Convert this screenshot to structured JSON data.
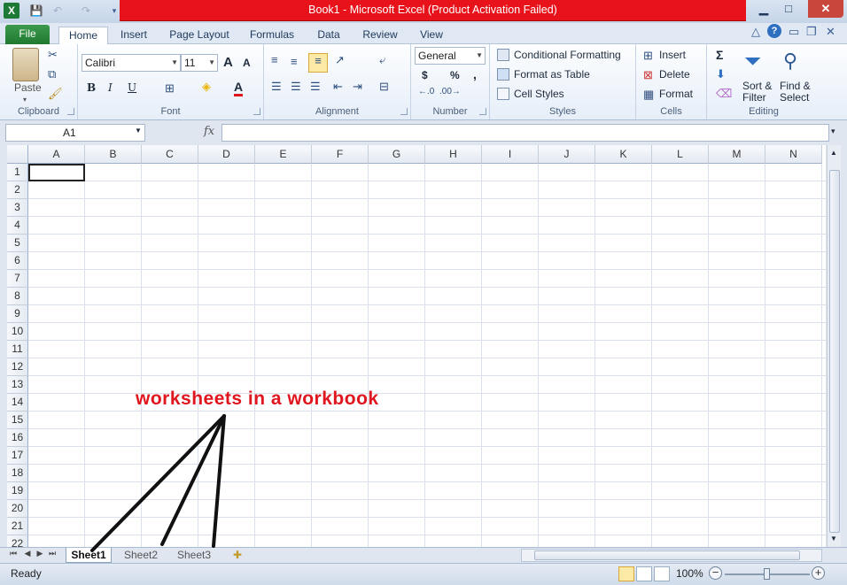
{
  "window": {
    "title": "Book1  -  Microsoft Excel (Product Activation Failed)",
    "minimize": "▁",
    "maximize": "□",
    "close": "✕"
  },
  "ribbon_tabs": [
    "File",
    "Home",
    "Insert",
    "Page Layout",
    "Formulas",
    "Data",
    "Review",
    "View"
  ],
  "clipboard": {
    "paste": "Paste",
    "label": "Clipboard"
  },
  "font": {
    "name": "Calibri",
    "size": "11",
    "bold": "B",
    "italic": "I",
    "underline": "U",
    "grow": "A",
    "shrink": "A",
    "font_color": "A",
    "label": "Font"
  },
  "alignment": {
    "label": "Alignment"
  },
  "number": {
    "format": "General",
    "currency": "$",
    "percent": "%",
    "comma": ",",
    "label": "Number"
  },
  "styles": {
    "conditional": "Conditional Formatting",
    "format_table": "Format as Table",
    "cell_styles": "Cell Styles",
    "label": "Styles"
  },
  "cells": {
    "insert": "Insert",
    "delete": "Delete",
    "format": "Format",
    "label": "Cells"
  },
  "editing": {
    "sum": "Σ",
    "sort_1": "Sort &",
    "sort_2": "Filter",
    "find_1": "Find &",
    "find_2": "Select",
    "label": "Editing"
  },
  "formula_bar": {
    "name_box": "A1",
    "fx": "fx",
    "content": ""
  },
  "columns": [
    "A",
    "B",
    "C",
    "D",
    "E",
    "F",
    "G",
    "H",
    "I",
    "J",
    "K",
    "L",
    "M",
    "N"
  ],
  "rows": [
    "1",
    "2",
    "3",
    "4",
    "5",
    "6",
    "7",
    "8",
    "9",
    "10",
    "11",
    "12",
    "13",
    "14",
    "15",
    "16",
    "17",
    "18",
    "19",
    "20",
    "21",
    "22"
  ],
  "sheets": [
    "Sheet1",
    "Sheet2",
    "Sheet3"
  ],
  "annotation": "worksheets in a workbook",
  "status": {
    "ready": "Ready",
    "zoom": "100%"
  },
  "colors": {
    "title_red": "#e8121a",
    "annotation_red": "#e0161e",
    "file_green": "#2a8a3a"
  }
}
